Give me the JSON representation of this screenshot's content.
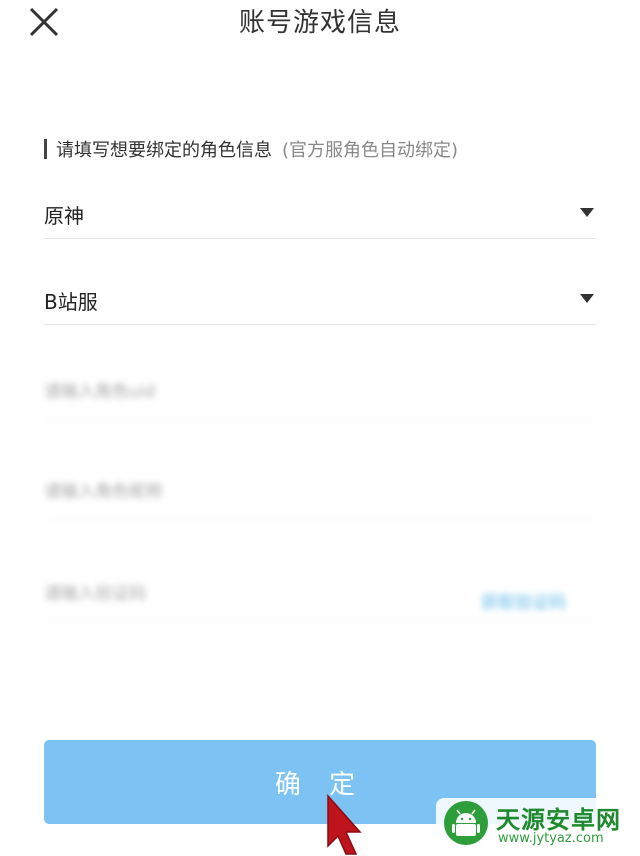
{
  "header": {
    "title": "账号游戏信息",
    "close_icon": "close-icon"
  },
  "form": {
    "section_label": "请填写想要绑定的角色信息",
    "section_note": "(官方服角色自动绑定)",
    "game_select": {
      "value": "原神",
      "icon": "caret-down-icon"
    },
    "server_select": {
      "value": "B站服",
      "icon": "caret-down-icon"
    },
    "blurred_fields": [
      {
        "placeholder": "请输入角色uid"
      },
      {
        "placeholder": "请输入角色昵称"
      },
      {
        "placeholder": "请输入验证码",
        "link": "获取验证码"
      }
    ]
  },
  "actions": {
    "confirm_label": "确 定"
  },
  "watermark": {
    "title": "天源安卓网",
    "url": "www.jytyaz.com"
  },
  "colors": {
    "button_bg": "#7cc3f4",
    "watermark_green": "#2e9e3a",
    "pointer_red": "#c0141c"
  }
}
